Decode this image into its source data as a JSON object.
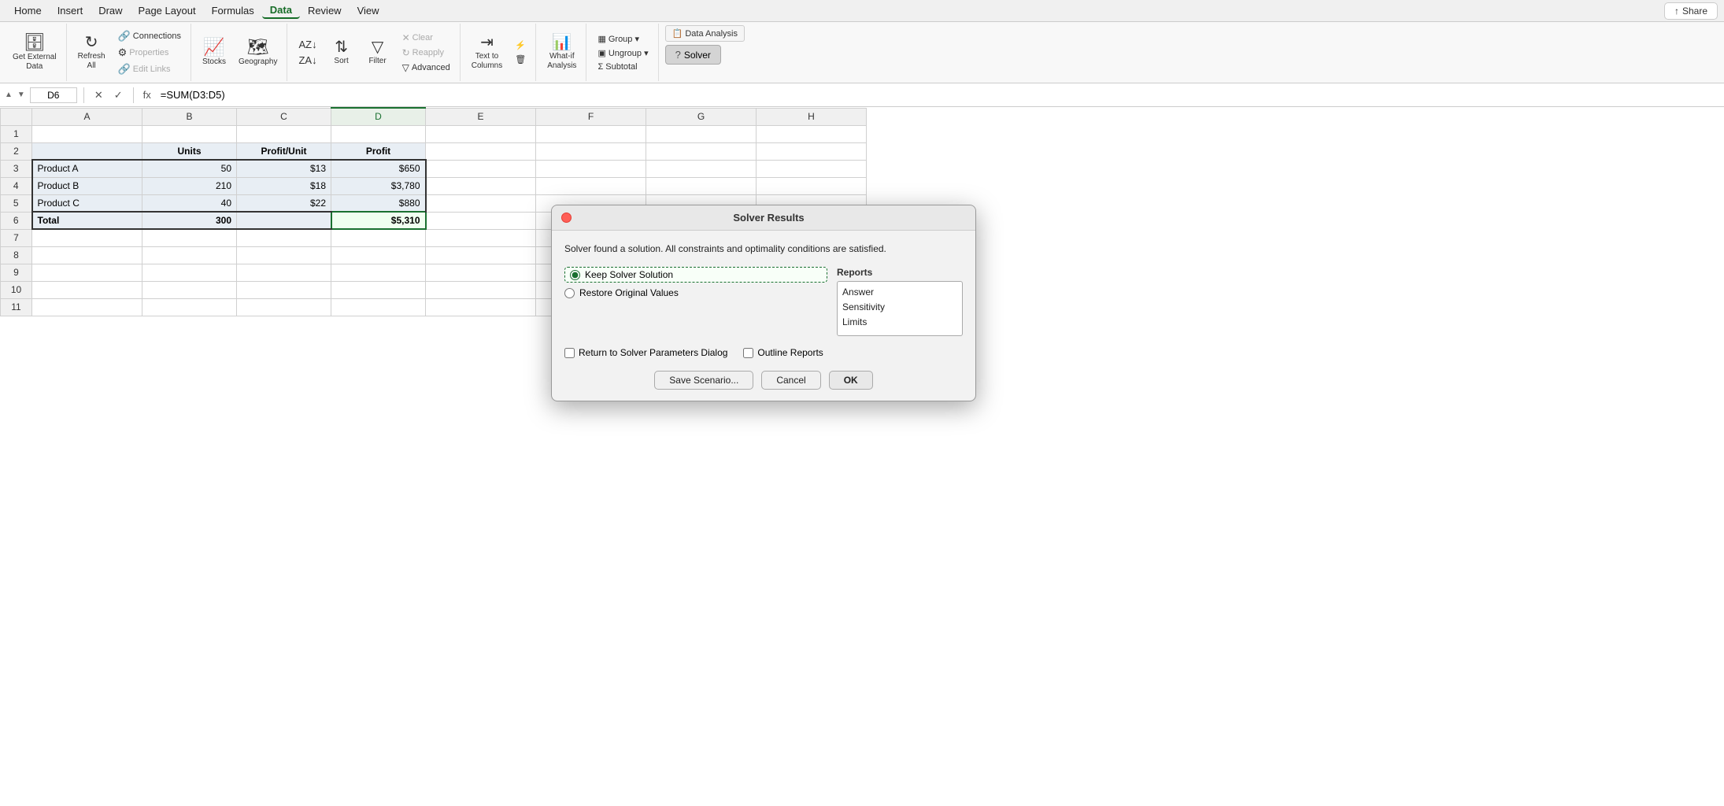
{
  "menu": {
    "items": [
      "Home",
      "Insert",
      "Draw",
      "Page Layout",
      "Formulas",
      "Data",
      "Review",
      "View"
    ],
    "active": "Data",
    "share_label": "Share",
    "share_icon": "↑"
  },
  "ribbon": {
    "groups": [
      {
        "id": "external-data",
        "label": "",
        "buttons": [
          {
            "id": "get-external-data",
            "label": "Get External\nData",
            "icon": "🗄"
          }
        ]
      },
      {
        "id": "refresh",
        "label": "",
        "buttons": [
          {
            "id": "refresh-all",
            "label": "Refresh\nAll",
            "icon": "↻"
          }
        ],
        "small_buttons": [
          {
            "id": "connections",
            "label": "Connections",
            "icon": "🔗"
          },
          {
            "id": "properties",
            "label": "Properties",
            "icon": "⚙"
          },
          {
            "id": "edit-links",
            "label": "Edit Links",
            "icon": "🔗"
          }
        ]
      },
      {
        "id": "data-types",
        "label": "",
        "buttons": [
          {
            "id": "stocks",
            "label": "Stocks",
            "icon": "📈"
          },
          {
            "id": "geography",
            "label": "Geography",
            "icon": "🗺"
          }
        ]
      },
      {
        "id": "sort-filter",
        "label": "",
        "buttons": [
          {
            "id": "sort",
            "label": "Sort",
            "icon": "⇅"
          },
          {
            "id": "filter",
            "label": "Filter",
            "icon": "▽"
          }
        ],
        "small_buttons": [
          {
            "id": "sort-az",
            "label": "",
            "icon": "AZ↓"
          },
          {
            "id": "sort-za",
            "label": "",
            "icon": "ZA↓"
          },
          {
            "id": "clear",
            "label": "Clear",
            "icon": "✕"
          },
          {
            "id": "reapply",
            "label": "Reapply",
            "icon": "↻"
          },
          {
            "id": "advanced",
            "label": "Advanced",
            "icon": "▽"
          }
        ]
      },
      {
        "id": "data-tools",
        "label": "",
        "buttons": [
          {
            "id": "text-to-columns",
            "label": "Text to\nColumns",
            "icon": "⇥"
          },
          {
            "id": "flash-fill",
            "label": "",
            "icon": "⚡"
          },
          {
            "id": "remove-duplicates",
            "label": "",
            "icon": "🗑"
          }
        ]
      },
      {
        "id": "forecast",
        "label": "",
        "buttons": [
          {
            "id": "what-if-analysis",
            "label": "What-if\nAnalysis",
            "icon": "📊"
          }
        ]
      },
      {
        "id": "outline",
        "label": "",
        "small_buttons": [
          {
            "id": "group",
            "label": "Group ▾",
            "icon": ""
          },
          {
            "id": "ungroup",
            "label": "Ungroup ▾",
            "icon": ""
          },
          {
            "id": "subtotal",
            "label": "Subtotal",
            "icon": ""
          }
        ]
      },
      {
        "id": "analysis",
        "label": "",
        "buttons": [
          {
            "id": "data-analysis",
            "label": "Data Analysis",
            "icon": "📋"
          },
          {
            "id": "solver",
            "label": "Solver",
            "icon": "?"
          }
        ]
      }
    ]
  },
  "formula_bar": {
    "cell_ref": "D6",
    "formula": "=SUM(D3:D5)",
    "cancel_label": "✕",
    "confirm_label": "✓",
    "fx_label": "fx"
  },
  "spreadsheet": {
    "col_headers": [
      "",
      "A",
      "B",
      "C",
      "D",
      "E",
      "F",
      "G",
      "H"
    ],
    "rows": [
      {
        "row": "1",
        "cells": [
          "",
          "",
          "",
          "",
          ""
        ]
      },
      {
        "row": "2",
        "cells": [
          "",
          "Units",
          "Profit/Unit",
          "Profit",
          ""
        ]
      },
      {
        "row": "3",
        "cells": [
          "Product A",
          "50",
          "$13",
          "$650",
          ""
        ]
      },
      {
        "row": "4",
        "cells": [
          "Product B",
          "210",
          "$18",
          "$3,780",
          ""
        ]
      },
      {
        "row": "5",
        "cells": [
          "Product C",
          "40",
          "$22",
          "$880",
          ""
        ]
      },
      {
        "row": "6",
        "cells": [
          "Total",
          "300",
          "",
          "$5,310",
          ""
        ]
      },
      {
        "row": "7",
        "cells": [
          "",
          "",
          "",
          "",
          ""
        ]
      },
      {
        "row": "8",
        "cells": [
          "",
          "",
          "",
          "",
          ""
        ]
      },
      {
        "row": "9",
        "cells": [
          "",
          "",
          "",
          "",
          ""
        ]
      },
      {
        "row": "10",
        "cells": [
          "",
          "",
          "",
          "",
          ""
        ]
      },
      {
        "row": "11",
        "cells": [
          "",
          "",
          "",
          "",
          ""
        ]
      }
    ]
  },
  "solver_dialog": {
    "title": "Solver Results",
    "message": "Solver found a solution.  All constraints and optimality\nconditions are satisfied.",
    "radio_options": [
      {
        "id": "keep-solver",
        "label": "Keep Solver Solution",
        "selected": true
      },
      {
        "id": "restore-original",
        "label": "Restore Original Values",
        "selected": false
      }
    ],
    "reports_label": "Reports",
    "reports_items": [
      "Answer",
      "Sensitivity",
      "Limits"
    ],
    "checkbox_options": [
      {
        "id": "return-to-solver",
        "label": "Return to Solver Parameters Dialog",
        "checked": false
      },
      {
        "id": "outline-reports",
        "label": "Outline Reports",
        "checked": false
      }
    ],
    "buttons": [
      {
        "id": "save-scenario",
        "label": "Save Scenario..."
      },
      {
        "id": "cancel",
        "label": "Cancel"
      },
      {
        "id": "ok",
        "label": "OK"
      }
    ]
  }
}
